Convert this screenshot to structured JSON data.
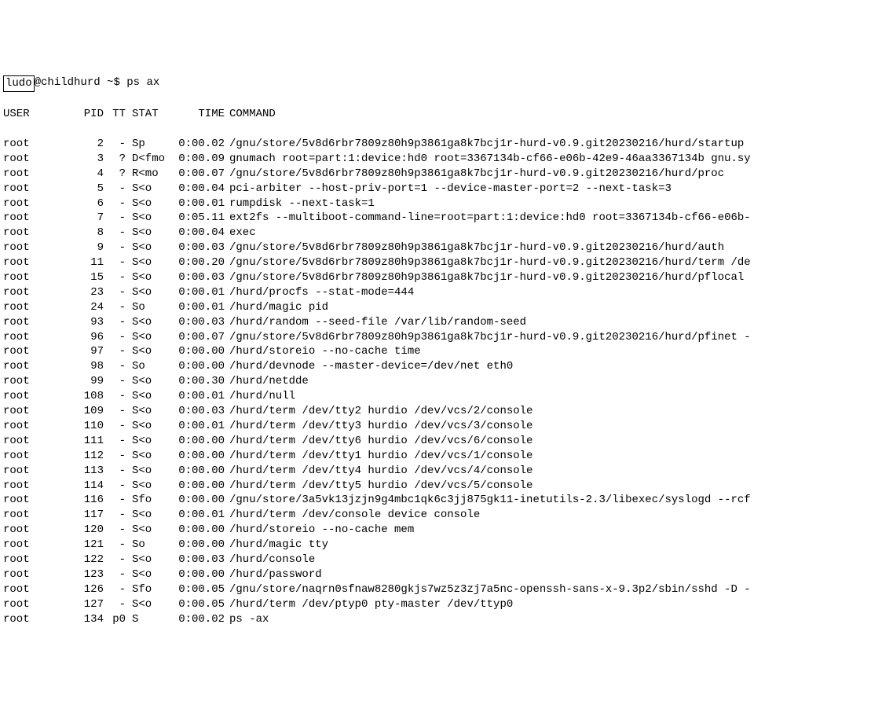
{
  "prompt": {
    "user": "ludo",
    "host": "childhurd",
    "cwd": "~",
    "symbol": "$",
    "command": "ps ax"
  },
  "header": {
    "user": "USER",
    "pid": "PID",
    "tt": "TT",
    "stat": "STAT",
    "time": "TIME",
    "command": "COMMAND"
  },
  "processes": [
    {
      "user": "root",
      "pid": "2",
      "tt": "-",
      "stat": "Sp",
      "time": "0:00.02",
      "cmd": "/gnu/store/5v8d6rbr7809z80h9p3861ga8k7bcj1r-hurd-v0.9.git20230216/hurd/startup"
    },
    {
      "user": "root",
      "pid": "3",
      "tt": "?",
      "stat": "D<fmo",
      "time": "0:00.09",
      "cmd": "gnumach root=part:1:device:hd0 root=3367134b-cf66-e06b-42e9-46aa3367134b gnu.sy"
    },
    {
      "user": "root",
      "pid": "4",
      "tt": "?",
      "stat": "R<mo",
      "time": "0:00.07",
      "cmd": "/gnu/store/5v8d6rbr7809z80h9p3861ga8k7bcj1r-hurd-v0.9.git20230216/hurd/proc"
    },
    {
      "user": "root",
      "pid": "5",
      "tt": "-",
      "stat": "S<o",
      "time": "0:00.04",
      "cmd": "pci-arbiter --host-priv-port=1 --device-master-port=2 --next-task=3"
    },
    {
      "user": "root",
      "pid": "6",
      "tt": "-",
      "stat": "S<o",
      "time": "0:00.01",
      "cmd": "rumpdisk --next-task=1"
    },
    {
      "user": "root",
      "pid": "7",
      "tt": "-",
      "stat": "S<o",
      "time": "0:05.11",
      "cmd": "ext2fs --multiboot-command-line=root=part:1:device:hd0 root=3367134b-cf66-e06b-"
    },
    {
      "user": "root",
      "pid": "8",
      "tt": "-",
      "stat": "S<o",
      "time": "0:00.04",
      "cmd": "exec"
    },
    {
      "user": "root",
      "pid": "9",
      "tt": "-",
      "stat": "S<o",
      "time": "0:00.03",
      "cmd": "/gnu/store/5v8d6rbr7809z80h9p3861ga8k7bcj1r-hurd-v0.9.git20230216/hurd/auth"
    },
    {
      "user": "root",
      "pid": "11",
      "tt": "-",
      "stat": "S<o",
      "time": "0:00.20",
      "cmd": "/gnu/store/5v8d6rbr7809z80h9p3861ga8k7bcj1r-hurd-v0.9.git20230216/hurd/term /de"
    },
    {
      "user": "root",
      "pid": "15",
      "tt": "-",
      "stat": "S<o",
      "time": "0:00.03",
      "cmd": "/gnu/store/5v8d6rbr7809z80h9p3861ga8k7bcj1r-hurd-v0.9.git20230216/hurd/pflocal"
    },
    {
      "user": "root",
      "pid": "23",
      "tt": "-",
      "stat": "S<o",
      "time": "0:00.01",
      "cmd": "/hurd/procfs --stat-mode=444"
    },
    {
      "user": "root",
      "pid": "24",
      "tt": "-",
      "stat": "So",
      "time": "0:00.01",
      "cmd": "/hurd/magic pid"
    },
    {
      "user": "root",
      "pid": "93",
      "tt": "-",
      "stat": "S<o",
      "time": "0:00.03",
      "cmd": "/hurd/random --seed-file /var/lib/random-seed"
    },
    {
      "user": "root",
      "pid": "96",
      "tt": "-",
      "stat": "S<o",
      "time": "0:00.07",
      "cmd": "/gnu/store/5v8d6rbr7809z80h9p3861ga8k7bcj1r-hurd-v0.9.git20230216/hurd/pfinet -"
    },
    {
      "user": "root",
      "pid": "97",
      "tt": "-",
      "stat": "S<o",
      "time": "0:00.00",
      "cmd": "/hurd/storeio --no-cache time"
    },
    {
      "user": "root",
      "pid": "98",
      "tt": "-",
      "stat": "So",
      "time": "0:00.00",
      "cmd": "/hurd/devnode --master-device=/dev/net eth0"
    },
    {
      "user": "root",
      "pid": "99",
      "tt": "-",
      "stat": "S<o",
      "time": "0:00.30",
      "cmd": "/hurd/netdde"
    },
    {
      "user": "root",
      "pid": "108",
      "tt": "-",
      "stat": "S<o",
      "time": "0:00.01",
      "cmd": "/hurd/null"
    },
    {
      "user": "root",
      "pid": "109",
      "tt": "-",
      "stat": "S<o",
      "time": "0:00.03",
      "cmd": "/hurd/term /dev/tty2 hurdio /dev/vcs/2/console"
    },
    {
      "user": "root",
      "pid": "110",
      "tt": "-",
      "stat": "S<o",
      "time": "0:00.01",
      "cmd": "/hurd/term /dev/tty3 hurdio /dev/vcs/3/console"
    },
    {
      "user": "root",
      "pid": "111",
      "tt": "-",
      "stat": "S<o",
      "time": "0:00.00",
      "cmd": "/hurd/term /dev/tty6 hurdio /dev/vcs/6/console"
    },
    {
      "user": "root",
      "pid": "112",
      "tt": "-",
      "stat": "S<o",
      "time": "0:00.00",
      "cmd": "/hurd/term /dev/tty1 hurdio /dev/vcs/1/console"
    },
    {
      "user": "root",
      "pid": "113",
      "tt": "-",
      "stat": "S<o",
      "time": "0:00.00",
      "cmd": "/hurd/term /dev/tty4 hurdio /dev/vcs/4/console"
    },
    {
      "user": "root",
      "pid": "114",
      "tt": "-",
      "stat": "S<o",
      "time": "0:00.00",
      "cmd": "/hurd/term /dev/tty5 hurdio /dev/vcs/5/console"
    },
    {
      "user": "root",
      "pid": "116",
      "tt": "-",
      "stat": "Sfo",
      "time": "0:00.00",
      "cmd": "/gnu/store/3a5vk13jzjn9g4mbc1qk6c3jj875gk11-inetutils-2.3/libexec/syslogd --rcf"
    },
    {
      "user": "root",
      "pid": "117",
      "tt": "-",
      "stat": "S<o",
      "time": "0:00.01",
      "cmd": "/hurd/term /dev/console device console"
    },
    {
      "user": "root",
      "pid": "120",
      "tt": "-",
      "stat": "S<o",
      "time": "0:00.00",
      "cmd": "/hurd/storeio --no-cache mem"
    },
    {
      "user": "root",
      "pid": "121",
      "tt": "-",
      "stat": "So",
      "time": "0:00.00",
      "cmd": "/hurd/magic tty"
    },
    {
      "user": "root",
      "pid": "122",
      "tt": "-",
      "stat": "S<o",
      "time": "0:00.03",
      "cmd": "/hurd/console"
    },
    {
      "user": "root",
      "pid": "123",
      "tt": "-",
      "stat": "S<o",
      "time": "0:00.00",
      "cmd": "/hurd/password"
    },
    {
      "user": "root",
      "pid": "126",
      "tt": "-",
      "stat": "Sfo",
      "time": "0:00.05",
      "cmd": "/gnu/store/naqrn0sfnaw8280gkjs7wz5z3zj7a5nc-openssh-sans-x-9.3p2/sbin/sshd -D -"
    },
    {
      "user": "root",
      "pid": "127",
      "tt": "-",
      "stat": "S<o",
      "time": "0:00.05",
      "cmd": "/hurd/term /dev/ptyp0 pty-master /dev/ttyp0"
    },
    {
      "user": "root",
      "pid": "134",
      "tt": "p0",
      "stat": "S",
      "time": "0:00.02",
      "cmd": "ps -ax"
    }
  ]
}
